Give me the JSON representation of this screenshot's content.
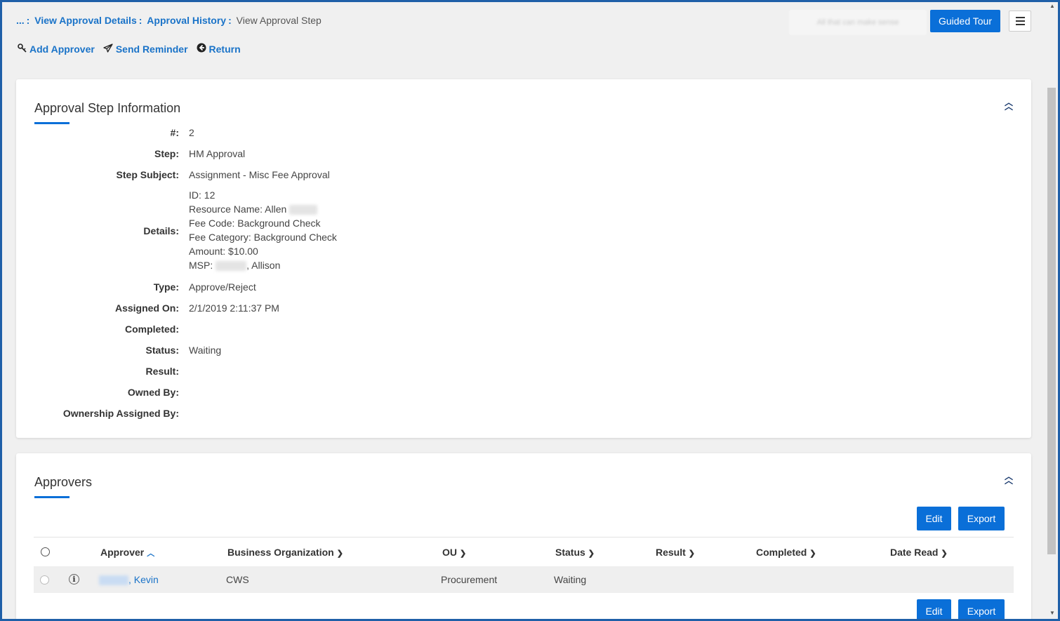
{
  "breadcrumb": {
    "ellipsis": "...",
    "sep": ":",
    "link1": "View Approval Details",
    "link2": "Approval History",
    "current": "View Approval Step"
  },
  "header": {
    "blurred_text": "All that can make sense",
    "guided_tour": "Guided Tour"
  },
  "actions": {
    "add_approver": "Add Approver",
    "send_reminder": "Send Reminder",
    "return": "Return"
  },
  "info_card": {
    "title": "Approval Step Information",
    "fields": {
      "num_label": "#:",
      "num_value": "2",
      "step_label": "Step:",
      "step_value": "HM Approval",
      "subject_label": "Step Subject:",
      "subject_value": "Assignment - Misc Fee Approval",
      "details_label": "Details:",
      "details_id": "ID: 12",
      "details_resource": "Resource Name: Allen",
      "details_fee_code": "Fee Code: Background Check",
      "details_fee_category": "Fee Category: Background Check",
      "details_amount": "Amount: $10.00",
      "details_msp_prefix": "MSP:",
      "details_msp_suffix": ", Allison",
      "type_label": "Type:",
      "type_value": "Approve/Reject",
      "assigned_label": "Assigned On:",
      "assigned_value": "2/1/2019 2:11:37 PM",
      "completed_label": "Completed:",
      "status_label": "Status:",
      "status_value": "Waiting",
      "result_label": "Result:",
      "owned_label": "Owned By:",
      "ownership_label": "Ownership Assigned By:"
    }
  },
  "approvers_card": {
    "title": "Approvers",
    "edit": "Edit",
    "export": "Export",
    "columns": {
      "approver": "Approver",
      "business_org": "Business Organization",
      "ou": "OU",
      "status": "Status",
      "result": "Result",
      "completed": "Completed",
      "date_read": "Date Read"
    },
    "rows": [
      {
        "approver_suffix": ", Kevin",
        "business_org": "CWS",
        "ou": "Procurement",
        "status": "Waiting"
      }
    ]
  },
  "colors": {
    "accent": "#0a6fd8",
    "link": "#1a73c8",
    "border_frame": "#1f5fa8"
  }
}
